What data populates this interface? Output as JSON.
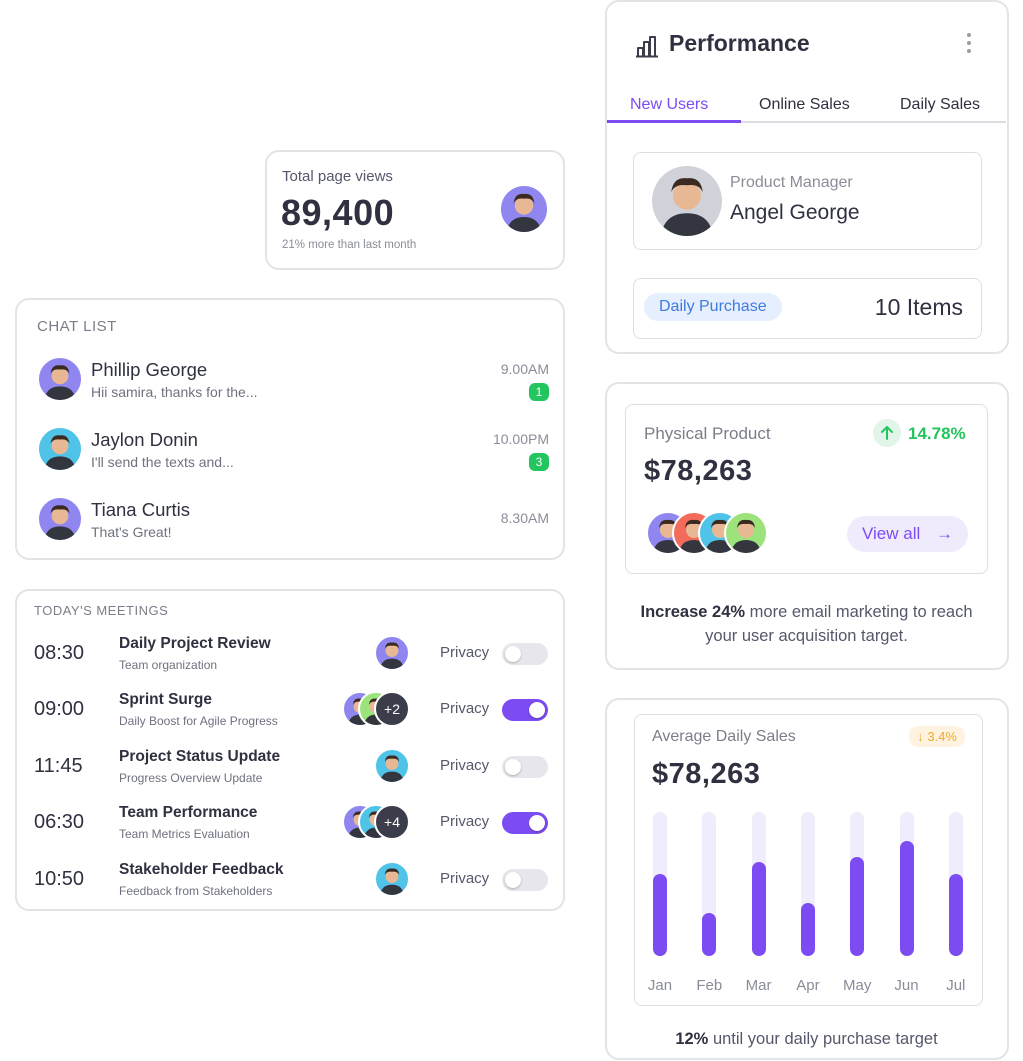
{
  "views": {
    "label": "Total page views",
    "value": "89,400",
    "subtitle": "21% more than last month"
  },
  "chat": {
    "title": "CHAT LIST",
    "items": [
      {
        "name": "Phillip George",
        "message": "Hii samira, thanks for the...",
        "time": "9.00AM",
        "badge": "1"
      },
      {
        "name": "Jaylon Donin",
        "message": "I'll send the texts and...",
        "time": "10.00PM",
        "badge": "3"
      },
      {
        "name": "Tiana Curtis",
        "message": "That's Great!",
        "time": "8.30AM",
        "badge": ""
      }
    ]
  },
  "meetings": {
    "title": "TODAY'S MEETINGS",
    "privacy_label": "Privacy",
    "items": [
      {
        "time": "08:30",
        "title": "Daily Project Review",
        "subtitle": "Team organization",
        "extra": "",
        "privacy_on": false
      },
      {
        "time": "09:00",
        "title": "Sprint Surge",
        "subtitle": "Daily Boost for Agile Progress",
        "extra": "+2",
        "privacy_on": true
      },
      {
        "time": "11:45",
        "title": "Project Status Update",
        "subtitle": "Progress Overview Update",
        "extra": "",
        "privacy_on": false
      },
      {
        "time": "06:30",
        "title": "Team Performance",
        "subtitle": "Team Metrics Evaluation",
        "extra": "+4",
        "privacy_on": true
      },
      {
        "time": "10:50",
        "title": "Stakeholder Feedback",
        "subtitle": "Feedback from Stakeholders",
        "extra": "",
        "privacy_on": false
      }
    ]
  },
  "performance": {
    "title": "Performance",
    "tabs": [
      "New Users",
      "Online Sales",
      "Daily Sales"
    ],
    "active_tab": 0,
    "person": {
      "role": "Product Manager",
      "name": "Angel George"
    },
    "purchase": {
      "label": "Daily Purchase",
      "value": "10 Items"
    }
  },
  "physical": {
    "label": "Physical Product",
    "change": "14.78%",
    "value": "$78,263",
    "view_all": "View all",
    "note_strong": "Increase 24%",
    "note_line1": "more email marketing to reach",
    "note_line2": "your user acquisition target."
  },
  "sales": {
    "label": "Average Daily Sales",
    "change": "↓ 3.4%",
    "value": "$78,263",
    "note_strong": "12%",
    "note_rest": "until your daily purchase target"
  },
  "chart_data": {
    "type": "bar",
    "categories": [
      "Jan",
      "Feb",
      "Mar",
      "Apr",
      "May",
      "Jun",
      "Jul"
    ],
    "values": [
      57,
      30,
      65,
      37,
      69,
      80,
      57
    ],
    "title": "Average Daily Sales",
    "xlabel": "",
    "ylabel": "",
    "ylim": [
      0,
      100
    ],
    "grid": false
  },
  "colors": {
    "accent": "#7c4cf2",
    "success": "#22c55e",
    "warning": "#f0a830",
    "info": "#3f7ae0"
  }
}
